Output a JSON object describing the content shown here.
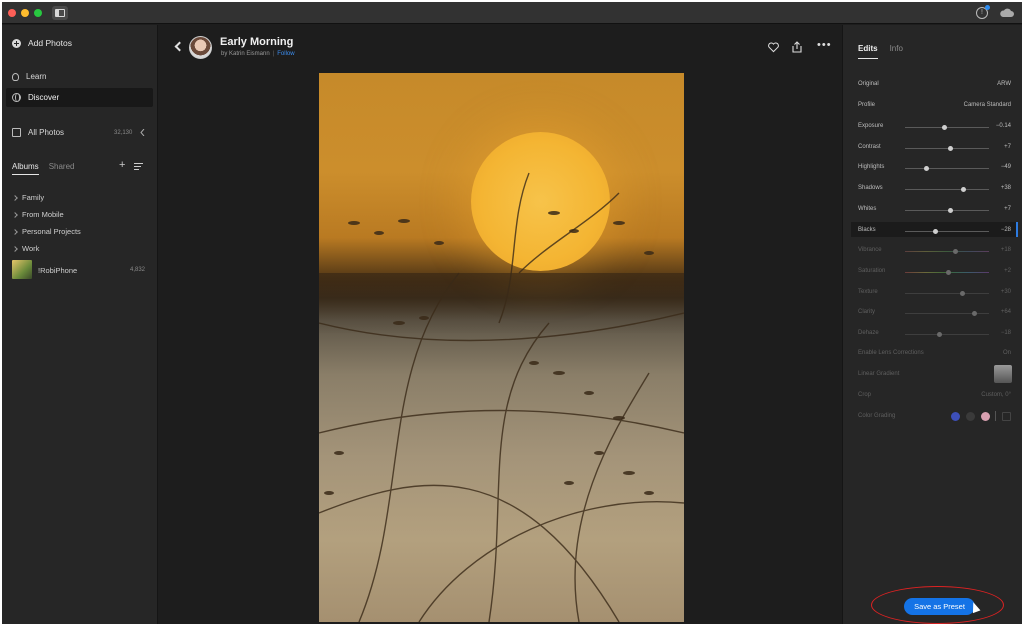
{
  "titlebar": {
    "info_icon": "info-icon",
    "cloud_icon": "cloud-icon"
  },
  "left_panel": {
    "add_photos": "Add Photos",
    "learn": "Learn",
    "discover": "Discover",
    "all_photos": "All Photos",
    "all_photos_count": "32,130",
    "tabs": [
      "Albums",
      "Shared"
    ],
    "albums": [
      {
        "label": "Family"
      },
      {
        "label": "From Mobile"
      },
      {
        "label": "Personal Projects"
      },
      {
        "label": "Work"
      }
    ],
    "robiphone": {
      "label": "!RobiPhone",
      "count": "4,832"
    }
  },
  "photo": {
    "title": "Early Morning",
    "author": "by Katrin Eismann",
    "follow": "Follow"
  },
  "right_panel": {
    "tabs": [
      "Edits",
      "Info"
    ],
    "original_label": "Original",
    "original_value": "ARW",
    "profile_label": "Profile",
    "profile_value": "Camera Standard",
    "sliders": [
      {
        "label": "Exposure",
        "value": "−0.14",
        "level": 0.47
      },
      {
        "label": "Contrast",
        "value": "+7",
        "level": 0.53
      },
      {
        "label": "Highlights",
        "value": "−49",
        "level": 0.25
      },
      {
        "label": "Shadows",
        "value": "+38",
        "level": 0.69
      },
      {
        "label": "Whites",
        "value": "+7",
        "level": 0.53
      },
      {
        "label": "Blacks",
        "value": "−28",
        "level": 0.36
      },
      {
        "label": "Vibrance",
        "value": "+18",
        "level": 0.59
      },
      {
        "label": "Saturation",
        "value": "+2",
        "level": 0.51
      },
      {
        "label": "Texture",
        "value": "+30",
        "level": 0.68
      },
      {
        "label": "Clarity",
        "value": "+64",
        "level": 0.82
      },
      {
        "label": "Dehaze",
        "value": "−18",
        "level": 0.41
      }
    ],
    "lens_label": "Enable Lens Corrections",
    "lens_value": "On",
    "linear_gradient_label": "Linear Gradient",
    "crop_label": "Crop",
    "crop_value": "Custom, 0°",
    "color_grading_label": "Color Grading",
    "color_grading_colors": [
      "#3d4fb8",
      "#3a3a3a",
      "#d8a0b0"
    ],
    "save_preset": "Save as Preset"
  },
  "colors": {
    "accent": "#1473e6",
    "follow": "#3b8df0",
    "highlight_ring": "#dd2222"
  }
}
